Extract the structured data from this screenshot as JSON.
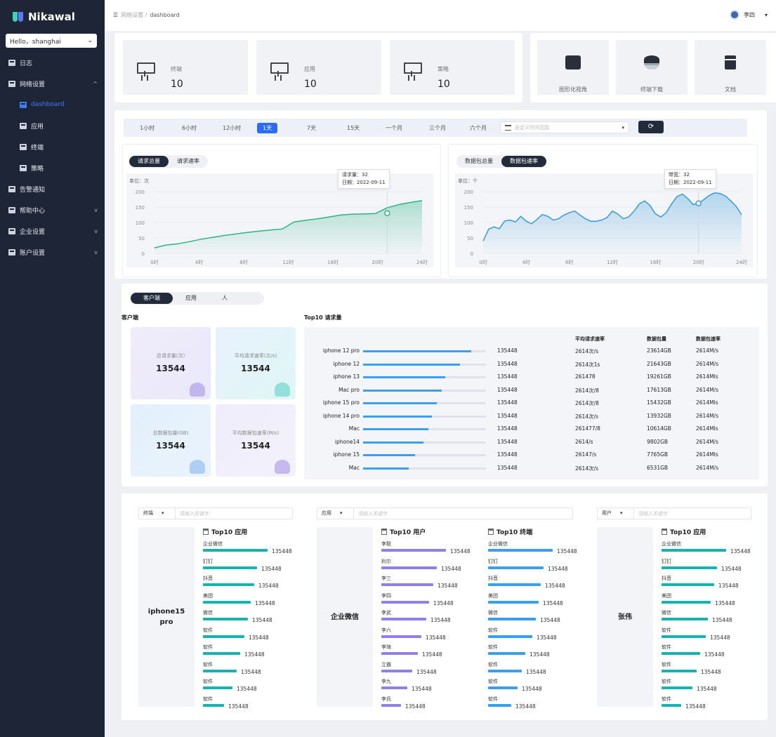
{
  "brand": "Nikawal",
  "site_select": "Hello，shanghai",
  "sidebar": [
    {
      "label": "日志",
      "sub": false,
      "active": false,
      "chev": ""
    },
    {
      "label": "网络设置",
      "sub": false,
      "active": false,
      "chev": "^"
    },
    {
      "label": "dashboard",
      "sub": true,
      "active": true,
      "chev": ""
    },
    {
      "label": "应用",
      "sub": true,
      "active": false,
      "chev": ""
    },
    {
      "label": "终端",
      "sub": true,
      "active": false,
      "chev": ""
    },
    {
      "label": "策略",
      "sub": true,
      "active": false,
      "chev": ""
    },
    {
      "label": "告警通知",
      "sub": false,
      "active": false,
      "chev": ""
    },
    {
      "label": "帮助中心",
      "sub": false,
      "active": false,
      "chev": "v"
    },
    {
      "label": "企业设置",
      "sub": false,
      "active": false,
      "chev": "v"
    },
    {
      "label": "账户设置",
      "sub": false,
      "active": false,
      "chev": "v"
    }
  ],
  "breadcrumb": {
    "parent": "网络设置 /",
    "current": "dashboard"
  },
  "user": {
    "name": "李四",
    "caret": "▾"
  },
  "stats": [
    {
      "label": "终端",
      "value": "10"
    },
    {
      "label": "应用",
      "value": "10"
    },
    {
      "label": "策略",
      "value": "10"
    }
  ],
  "quick_actions": [
    {
      "label": "图形化视角",
      "icon": "chart-icon"
    },
    {
      "label": "终端下载",
      "icon": "layers-icon"
    },
    {
      "label": "文档",
      "icon": "file-icon"
    }
  ],
  "time_ranges": [
    "1小时",
    "6小时",
    "12小时",
    "1天",
    "7天",
    "15天",
    "一个月",
    "三个月",
    "六个月"
  ],
  "time_active": 3,
  "custom_range_placeholder": "自定义时间范围",
  "refresh_icon": "⟳",
  "chart_left": {
    "tabs": [
      "请求总量",
      "请求速率"
    ],
    "active": 0,
    "unit": "单位：次",
    "tooltip": [
      "请求量：32",
      "日期：2022-09-11"
    ]
  },
  "chart_right": {
    "tabs": [
      "数据包总量",
      "数据包速率"
    ],
    "active": 1,
    "unit": "单位：个",
    "tooltip": [
      "带宽：32",
      "日期：2022-09-11"
    ]
  },
  "chart_data": [
    {
      "type": "area",
      "ylabel": "单位：次",
      "ylim": [
        0,
        200
      ],
      "yticks": [
        "0",
        "50",
        "100",
        "150",
        "200"
      ],
      "xticks": [
        "0时",
        "4时",
        "8时",
        "12时",
        "16时",
        "20时",
        "24时"
      ],
      "x": [
        0,
        1,
        2,
        3,
        4,
        5,
        6,
        7,
        8,
        9,
        10,
        11,
        12,
        13,
        14,
        15,
        16,
        17,
        18,
        19,
        20,
        21,
        22,
        23
      ],
      "values": [
        18,
        27,
        31,
        38,
        46,
        52,
        58,
        63,
        68,
        72,
        76,
        79,
        102,
        107,
        112,
        118,
        124,
        127,
        128,
        129,
        148,
        158,
        165,
        171
      ],
      "highlight": {
        "x": 20,
        "value": 130
      },
      "color": "#2fb383"
    },
    {
      "type": "area",
      "ylabel": "单位：个",
      "ylim": [
        0,
        200
      ],
      "yticks": [
        "0",
        "50",
        "100",
        "150",
        "200"
      ],
      "xticks": [
        "0时",
        "4时",
        "8时",
        "12时",
        "16时",
        "20时",
        "24时"
      ],
      "x": [
        0,
        0.5,
        1,
        1.5,
        2,
        2.5,
        3,
        3.5,
        4,
        4.5,
        5,
        5.5,
        6,
        6.5,
        7,
        7.5,
        8,
        8.5,
        9,
        9.5,
        10,
        10.5,
        11,
        11.5,
        12,
        12.5,
        13,
        13.5,
        14,
        14.5,
        15,
        15.5,
        16,
        16.5,
        17,
        17.5,
        18,
        18.5,
        19,
        19.5,
        20,
        20.5,
        21,
        21.5,
        22,
        22.5,
        23,
        23.5,
        24
      ],
      "values": [
        40,
        78,
        86,
        80,
        105,
        108,
        102,
        120,
        104,
        96,
        110,
        126,
        120,
        108,
        112,
        124,
        132,
        137,
        124,
        112,
        104,
        104,
        108,
        116,
        137,
        128,
        112,
        118,
        136,
        160,
        170,
        155,
        128,
        118,
        132,
        160,
        184,
        192,
        178,
        158,
        162,
        174,
        188,
        196,
        194,
        186,
        170,
        152,
        125
      ],
      "highlight": {
        "x": 20,
        "value": 162
      },
      "color": "#3a9ad6"
    }
  ],
  "client_tabs": [
    "客户端",
    "应用",
    "人"
  ],
  "client_active": 0,
  "client_heading": "客户端",
  "top10_heading": "Top10 请求量",
  "kpis": [
    {
      "label": "总请求量(次)",
      "value": "13544"
    },
    {
      "label": "平均请求速率(次/s)",
      "value": "13544"
    },
    {
      "label": "总数据包量(GB)",
      "value": "13544"
    },
    {
      "label": "平均数据包速率(M/s)",
      "value": "13544"
    }
  ],
  "top10_columns": [
    "平均请求速率",
    "数据包量",
    "数据包速率"
  ],
  "top10": [
    {
      "name": "iphone 12 pro",
      "value": "135448",
      "ratio": 0.88,
      "c1": "2614次/s",
      "c2": "23614GB",
      "c3": "2614M/s"
    },
    {
      "name": "iphone 12",
      "value": "135448",
      "ratio": 0.79,
      "c1": "2614次1s",
      "c2": "21643GB",
      "c3": "2614M/s"
    },
    {
      "name": "iphone 13",
      "value": "135448",
      "ratio": 0.67,
      "c1": "261478",
      "c2": "19261GB",
      "c3": "2614MIs"
    },
    {
      "name": "Mac pro",
      "value": "135448",
      "ratio": 0.64,
      "c1": "2614次/8",
      "c2": "17613GB",
      "c3": "2614M/s"
    },
    {
      "name": "iphone 15 pro",
      "value": "135448",
      "ratio": 0.6,
      "c1": "2614次/8",
      "c2": "15432GB",
      "c3": "2614MIs"
    },
    {
      "name": "iphone 14 pro",
      "value": "135448",
      "ratio": 0.56,
      "c1": "2614次/s",
      "c2": "13932GB",
      "c3": "2614M/s"
    },
    {
      "name": "Mac",
      "value": "135448",
      "ratio": 0.53,
      "c1": "261477/8",
      "c2": "10614GB",
      "c3": "2614MIs"
    },
    {
      "name": "iphone14",
      "value": "135448",
      "ratio": 0.49,
      "c1": "2614/s",
      "c2": "9802GB",
      "c3": "2614M/s"
    },
    {
      "name": "iphone 15",
      "value": "135448",
      "ratio": 0.42,
      "c1": "26147/s",
      "c2": "7765GB",
      "c3": "2614MIs"
    },
    {
      "name": "Mac",
      "value": "135448",
      "ratio": 0.37,
      "c1": "2614次/s",
      "c2": "6531GB",
      "c3": "2614M/s"
    }
  ],
  "panels": [
    {
      "select": "终端",
      "placeholder": "请输入关键字",
      "entity": "iphone15\npro",
      "lists": [
        {
          "title": "Top10 应用",
          "color": "#17b3b0",
          "items": [
            [
              "企业微信",
              "135448",
              1.0
            ],
            [
              "钉钉",
              "135448",
              0.84
            ],
            [
              "抖音",
              "135448",
              0.79
            ],
            [
              "美团",
              "135448",
              0.74
            ],
            [
              "微信",
              "135448",
              0.7
            ],
            [
              "软件",
              "135448",
              0.64
            ],
            [
              "软件",
              "135448",
              0.58
            ],
            [
              "软件",
              "135448",
              0.52
            ],
            [
              "软件",
              "135448",
              0.46
            ],
            [
              "软件",
              "135448",
              0.33
            ]
          ]
        }
      ]
    },
    {
      "select": "应用",
      "placeholder": "请输入关键字",
      "entity": "企业微信",
      "lists": [
        {
          "title": "Top10 用户",
          "color": "#8f80e8",
          "items": [
            [
              "李毅",
              "135448",
              1.0
            ],
            [
              "利尔",
              "135448",
              0.86
            ],
            [
              "李三",
              "135448",
              0.8
            ],
            [
              "李四",
              "135448",
              0.74
            ],
            [
              "李武",
              "135448",
              0.7
            ],
            [
              "李六",
              "135448",
              0.62
            ],
            [
              "李琦",
              "135448",
              0.56
            ],
            [
              "立霸",
              "135448",
              0.48
            ],
            [
              "李九",
              "135448",
              0.4
            ],
            [
              "李氏",
              "135448",
              0.3
            ]
          ]
        },
        {
          "title": "Top10 终端",
          "color": "#3a9ff0",
          "items": [
            [
              "企业微信",
              "135448",
              1.0
            ],
            [
              "钉钉",
              "135448",
              0.86
            ],
            [
              "抖音",
              "135448",
              0.82
            ],
            [
              "美团",
              "135448",
              0.78
            ],
            [
              "微信",
              "135448",
              0.74
            ],
            [
              "软件",
              "135448",
              0.68
            ],
            [
              "软件",
              "135448",
              0.58
            ],
            [
              "软件",
              "135448",
              0.52
            ],
            [
              "软件",
              "135448",
              0.46
            ],
            [
              "软件",
              "135448",
              0.36
            ]
          ]
        }
      ]
    },
    {
      "select": "用户",
      "placeholder": "请输入关键字",
      "entity": "张伟",
      "lists": [
        {
          "title": "Top10 应用",
          "color": "#17b3b0",
          "items": [
            [
              "企业微信",
              "135448",
              1.0
            ],
            [
              "钉钉",
              "135448",
              0.86
            ],
            [
              "抖音",
              "135448",
              0.82
            ],
            [
              "美团",
              "135448",
              0.76
            ],
            [
              "微信",
              "135448",
              0.72
            ],
            [
              "软件",
              "135448",
              0.68
            ],
            [
              "软件",
              "135448",
              0.6
            ],
            [
              "软件",
              "135448",
              0.54
            ],
            [
              "软件",
              "135448",
              0.48
            ],
            [
              "软件",
              "135448",
              0.3
            ]
          ]
        }
      ]
    }
  ]
}
